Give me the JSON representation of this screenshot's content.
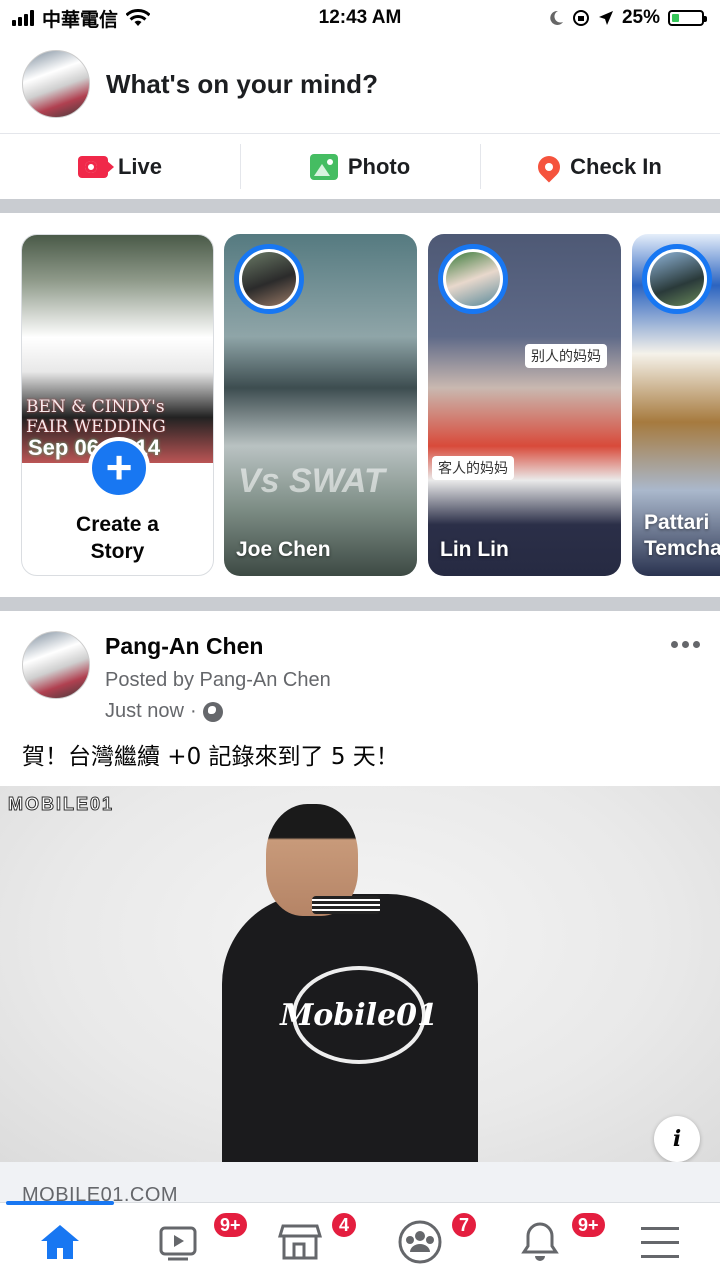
{
  "status_bar": {
    "carrier": "中華電信",
    "time": "12:43 AM",
    "battery_percent": "25%",
    "battery_level": 0.25
  },
  "composer": {
    "prompt": "What's on your mind?"
  },
  "actions": [
    {
      "label": "Live",
      "icon": "live-video-icon",
      "color": "#f02849"
    },
    {
      "label": "Photo",
      "icon": "photo-icon",
      "color": "#45bd62"
    },
    {
      "label": "Check In",
      "icon": "location-pin-icon",
      "color": "#f5533d"
    }
  ],
  "stories": {
    "create": {
      "label_line1": "Create a",
      "label_line2": "Story",
      "photo_caption_line1": "BEN & CINDY's",
      "photo_caption_line2": "FAIR WEDDING",
      "photo_date": "Sep 06, 2014"
    },
    "items": [
      {
        "name": "Joe Chen",
        "overlay_text": "Vs SWAT"
      },
      {
        "name": "Lin Lin",
        "tag1": "别人的妈妈",
        "tag2": "客人的妈妈"
      },
      {
        "name_line1": "Pattari",
        "name_line2": "Temcha"
      }
    ]
  },
  "post": {
    "author": "Pang-An Chen",
    "byline": "Posted by Pang-An Chen",
    "time": "Just now",
    "separator": "·",
    "text": "賀！台灣繼續 +0 記錄來到了 5 天！",
    "image_watermark": "MOBILE01",
    "image_logo_text": "Mobile01",
    "link_domain": "MOBILE01.COM"
  },
  "tabbar": [
    {
      "name": "home",
      "icon": "home-icon",
      "badge": ""
    },
    {
      "name": "watch",
      "icon": "video-icon",
      "badge": "9+"
    },
    {
      "name": "marketplace",
      "icon": "marketplace-icon",
      "badge": "4"
    },
    {
      "name": "groups",
      "icon": "groups-icon",
      "badge": "7"
    },
    {
      "name": "notifications",
      "icon": "bell-icon",
      "badge": "9+"
    },
    {
      "name": "menu",
      "icon": "menu-icon",
      "badge": ""
    }
  ],
  "colors": {
    "accent": "#1877f2",
    "badge": "#e41e3f",
    "secondary_text": "#65676b"
  }
}
